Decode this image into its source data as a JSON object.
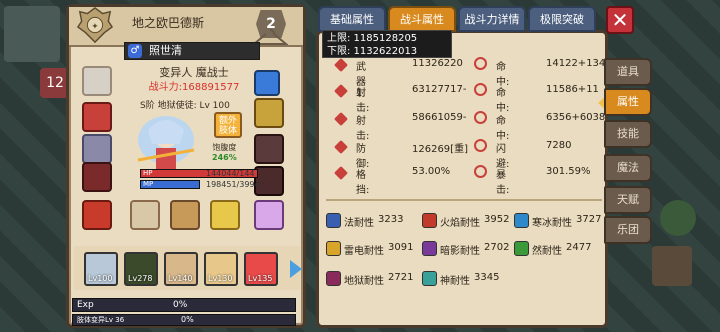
{
  "header": {
    "title": "地之欧巴德斯",
    "level_badge": "2"
  },
  "character": {
    "name": "照世清",
    "job": "变异人  魔战士",
    "power_label": "战斗力:",
    "power_value": "168891577",
    "rank_line": "S阶 地狱使徒: Lv 100",
    "extra_body": "额外\n肢体",
    "satiety_label": "饱腹度",
    "satiety_value": "246%",
    "hp_label": "HP",
    "hp_value": "144044/144",
    "hp_fraction": 1.0,
    "mp_label": "MP",
    "mp_value": "198451/3994",
    "mp_fraction": 1.0
  },
  "skills": [
    {
      "label": "Lv100"
    },
    {
      "label": "Lv278"
    },
    {
      "label": "Lv140"
    },
    {
      "label": "Lv130"
    },
    {
      "label": "Lv135"
    }
  ],
  "exp": {
    "label": "Exp",
    "value": "0%"
  },
  "body_change": {
    "label": "肢体变异Lv 36",
    "value": "0%"
  },
  "tabs": [
    {
      "label": "基础属性",
      "active": false
    },
    {
      "label": "战斗属性",
      "active": true
    },
    {
      "label": "战斗力详情",
      "active": false
    },
    {
      "label": "极限突破",
      "active": false
    }
  ],
  "tooltip": {
    "upper": "上限: 1185128205",
    "lower": "下限: 1132622013"
  },
  "stats": [
    {
      "label": "武器1:",
      "value": "11326220",
      "label2": "命中:",
      "value2": "14122+134"
    },
    {
      "label": "射击:",
      "value": "63127717-",
      "label2": "命中:",
      "value2": "11586+11"
    },
    {
      "label": "射击:",
      "value": "58661059-",
      "label2": "命中:",
      "value2": "6356+6038"
    },
    {
      "label": "防御:",
      "value": "126269[重]",
      "label2": "闪避:",
      "value2": "7280"
    },
    {
      "label": "格挡:",
      "value": "53.00%",
      "label2": "暴击:",
      "value2": "301.59%"
    }
  ],
  "resistances": [
    {
      "label": "法耐性",
      "value": "3233",
      "color": "#3b5fb0"
    },
    {
      "label": "火焰耐性",
      "value": "3952",
      "color": "#c23a2a"
    },
    {
      "label": "寒冰耐性",
      "value": "3727",
      "color": "#2e88c9"
    },
    {
      "label": "雷电耐性",
      "value": "3091",
      "color": "#d8a42a"
    },
    {
      "label": "暗影耐性",
      "value": "2702",
      "color": "#7a3a9a"
    },
    {
      "label": "然耐性",
      "value": "2477",
      "color": "#3a9a3a"
    },
    {
      "label": "地狱耐性",
      "value": "2721",
      "color": "#8a2a5a"
    },
    {
      "label": "神耐性",
      "value": "3345",
      "color": "#3aa09a"
    }
  ],
  "side_menu": [
    {
      "label": "道具",
      "active": false
    },
    {
      "label": "属性",
      "active": true
    },
    {
      "label": "技能",
      "active": false
    },
    {
      "label": "魔法",
      "active": false
    },
    {
      "label": "天赋",
      "active": false
    },
    {
      "label": "乐团",
      "active": false
    }
  ],
  "close_icon": "close-icon"
}
